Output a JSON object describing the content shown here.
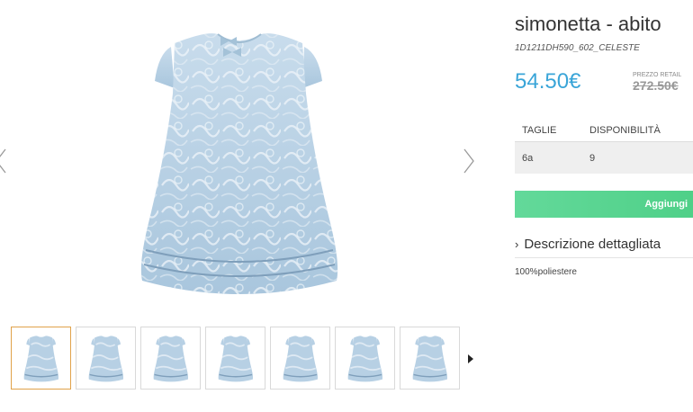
{
  "product": {
    "title": "simonetta - abito",
    "sku": "1D1211DH590_602_CELESTE",
    "price": "54.50€",
    "retail_label": "PREZZO RETAIL",
    "retail_price": "272.50€"
  },
  "sizes": {
    "header_size": "TAGLIE",
    "header_availability": "DISPONIBILITÀ",
    "rows": [
      {
        "size": "6a",
        "availability": "9"
      }
    ]
  },
  "actions": {
    "add_label": "Aggiungi"
  },
  "description": {
    "toggle_label": "Descrizione dettagliata",
    "text": "100%poliestere"
  },
  "gallery": {
    "thumbnail_count": 7,
    "active_index": 0,
    "icons": {
      "prev": "chevron-left-icon",
      "next": "chevron-right-icon",
      "thumbs_next": "caret-right-icon"
    }
  },
  "colors": {
    "price": "#3aa5d8",
    "add_button": "#5bd591",
    "dress": "#b7d2e6",
    "active_thumb_border": "#e0a24a"
  }
}
